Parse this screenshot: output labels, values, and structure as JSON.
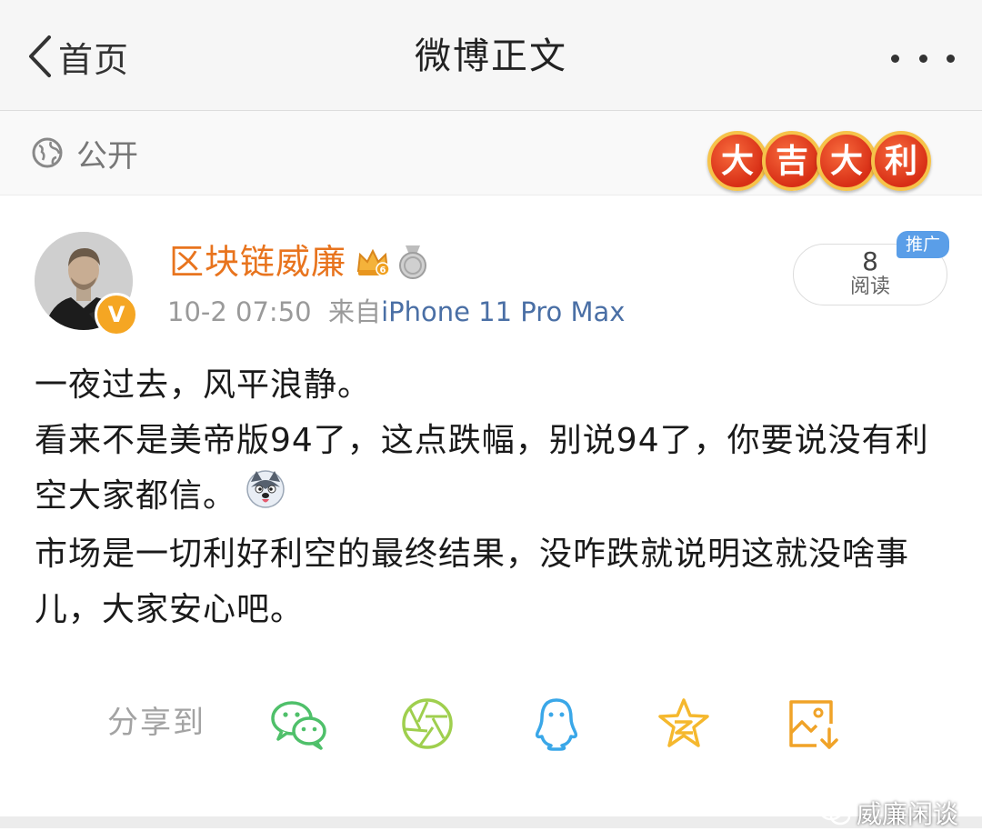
{
  "nav": {
    "back_label": "首页",
    "title": "微博正文"
  },
  "visibility": {
    "label": "公开",
    "lucky_chars": [
      "大",
      "吉",
      "大",
      "利"
    ]
  },
  "post": {
    "username": "区块链威廉",
    "verified_badge": "V",
    "time": "10-2 07:50",
    "source_prefix": "来自",
    "source": "iPhone 11 Pro Max",
    "read_count": "8",
    "read_label": "阅读",
    "promo_tag": "推广",
    "lines": [
      "一夜过去，风平浪静。",
      "看来不是美帝版94了，这点跌幅，别说94了，你要说没有利空大家都信。",
      "市场是一切利好利空的最终结果，没咋跌就说明这就没啥事儿，大家安心吧。"
    ]
  },
  "share": {
    "label": "分享到",
    "targets": [
      "wechat-icon",
      "moments-icon",
      "qq-icon",
      "qzone-icon",
      "save-image-icon"
    ]
  },
  "watermark": "威廉闲谈",
  "colors": {
    "username": "#e8741e",
    "source_link": "#4a6fa5",
    "share_green": "#4fc06a",
    "share_blue": "#3aa7e8",
    "share_yellow": "#f5b82e",
    "promo": "#5a9ee8"
  }
}
